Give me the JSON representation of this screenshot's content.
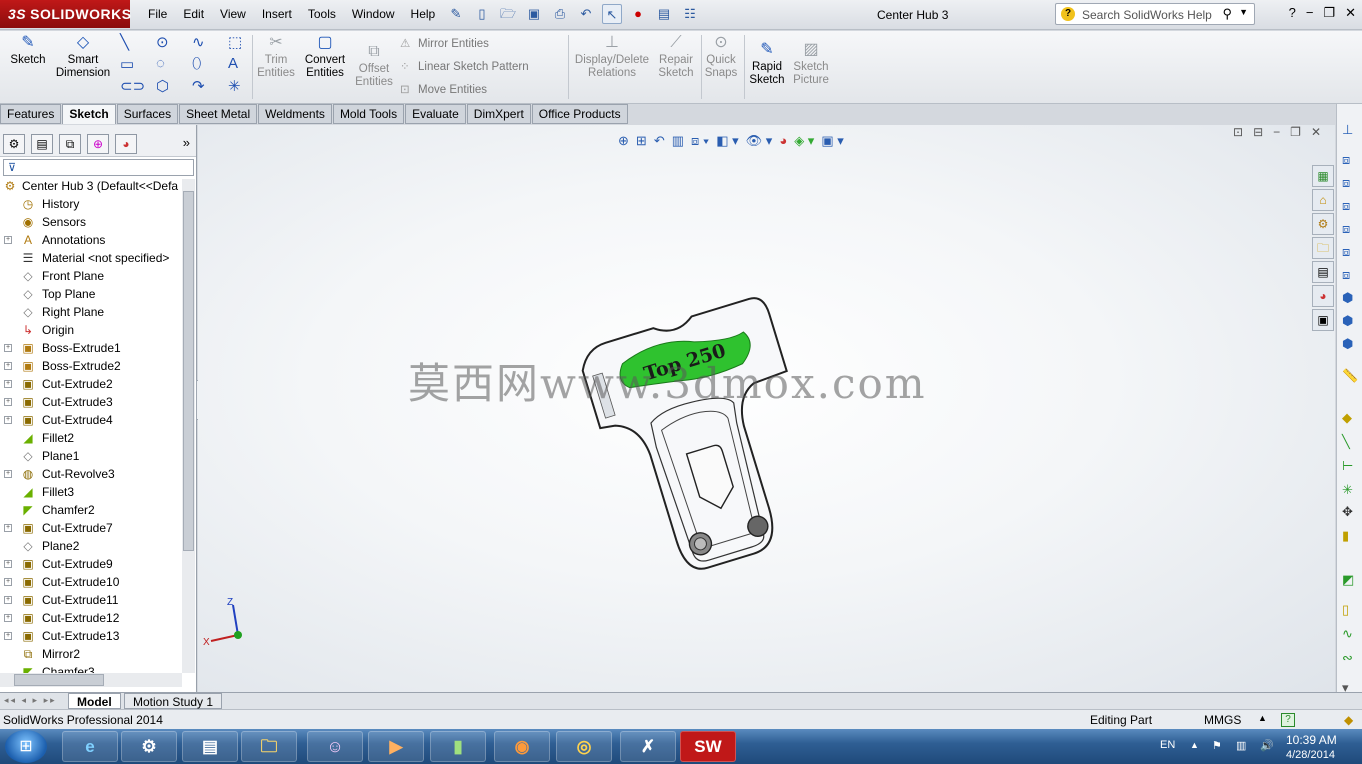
{
  "app": {
    "logo_text": "SOLIDWORKS",
    "logo_mark": "3S",
    "document_title": "Center Hub 3"
  },
  "menu": [
    "File",
    "Edit",
    "View",
    "Insert",
    "Tools",
    "Window",
    "Help"
  ],
  "search": {
    "placeholder": "Search SolidWorks Help"
  },
  "command_manager": {
    "sketch": "Sketch",
    "smart_dimension_1": "Smart",
    "smart_dimension_2": "Dimension",
    "trim_1": "Trim",
    "trim_2": "Entities",
    "convert_1": "Convert",
    "convert_2": "Entities",
    "offset_1": "Offset",
    "offset_2": "Entities",
    "mirror": "Mirror Entities",
    "linear_pattern": "Linear Sketch Pattern",
    "move": "Move Entities",
    "display_delete_1": "Display/Delete",
    "display_delete_2": "Relations",
    "repair_1": "Repair",
    "repair_2": "Sketch",
    "quick_snaps_1": "Quick",
    "quick_snaps_2": "Snaps",
    "rapid_1": "Rapid",
    "rapid_2": "Sketch",
    "picture_1": "Sketch",
    "picture_2": "Picture"
  },
  "tabs": [
    "Features",
    "Sketch",
    "Surfaces",
    "Sheet Metal",
    "Weldments",
    "Mold Tools",
    "Evaluate",
    "DimXpert",
    "Office Products"
  ],
  "active_tab": "Sketch",
  "tree": {
    "root": "Center Hub 3  (Default<<Defa",
    "items": [
      {
        "label": "History",
        "icon": "history-icon",
        "exp": false
      },
      {
        "label": "Sensors",
        "icon": "sensor-icon",
        "exp": false
      },
      {
        "label": "Annotations",
        "icon": "annotation-icon",
        "exp": true
      },
      {
        "label": "Material <not specified>",
        "icon": "material-icon",
        "exp": false
      },
      {
        "label": "Front Plane",
        "icon": "plane-icon",
        "exp": false
      },
      {
        "label": "Top Plane",
        "icon": "plane-icon",
        "exp": false
      },
      {
        "label": "Right Plane",
        "icon": "plane-icon",
        "exp": false
      },
      {
        "label": "Origin",
        "icon": "origin-icon",
        "exp": false
      },
      {
        "label": "Boss-Extrude1",
        "icon": "boss-extrude-icon",
        "exp": true
      },
      {
        "label": "Boss-Extrude2",
        "icon": "boss-extrude-icon",
        "exp": true
      },
      {
        "label": "Cut-Extrude2",
        "icon": "cut-extrude-icon",
        "exp": true
      },
      {
        "label": "Cut-Extrude3",
        "icon": "cut-extrude-icon",
        "exp": true
      },
      {
        "label": "Cut-Extrude4",
        "icon": "cut-extrude-icon",
        "exp": true
      },
      {
        "label": "Fillet2",
        "icon": "fillet-icon",
        "exp": false
      },
      {
        "label": "Plane1",
        "icon": "plane-icon",
        "exp": false
      },
      {
        "label": "Cut-Revolve3",
        "icon": "cut-revolve-icon",
        "exp": true
      },
      {
        "label": "Fillet3",
        "icon": "fillet-icon",
        "exp": false
      },
      {
        "label": "Chamfer2",
        "icon": "chamfer-icon",
        "exp": false
      },
      {
        "label": "Cut-Extrude7",
        "icon": "cut-extrude-icon",
        "exp": true
      },
      {
        "label": "Plane2",
        "icon": "plane-icon",
        "exp": false
      },
      {
        "label": "Cut-Extrude9",
        "icon": "cut-extrude-icon",
        "exp": true
      },
      {
        "label": "Cut-Extrude10",
        "icon": "cut-extrude-icon",
        "exp": true
      },
      {
        "label": "Cut-Extrude11",
        "icon": "cut-extrude-icon",
        "exp": true
      },
      {
        "label": "Cut-Extrude12",
        "icon": "cut-extrude-icon",
        "exp": true
      },
      {
        "label": "Cut-Extrude13",
        "icon": "cut-extrude-icon",
        "exp": true
      },
      {
        "label": "Mirror2",
        "icon": "mirror-icon",
        "exp": false
      },
      {
        "label": "Chamfer3",
        "icon": "chamfer-icon",
        "exp": false
      }
    ]
  },
  "graphics": {
    "watermark": "莫西网www.3dmox.com",
    "part_label": "Top 250",
    "triad_z": "Z",
    "triad_x": "X"
  },
  "bottom_tabs": [
    "Model",
    "Motion Study 1"
  ],
  "status": {
    "left": "SolidWorks Professional 2014",
    "mode": "Editing Part",
    "units": "MMGS"
  },
  "taskbar": {
    "language": "EN",
    "time": "10:39 AM",
    "date": "4/28/2014",
    "sw_label": "SW"
  },
  "colors": {
    "accent": "#1f57b8",
    "part_green": "#2fc22f",
    "logo_red": "#b31414"
  }
}
